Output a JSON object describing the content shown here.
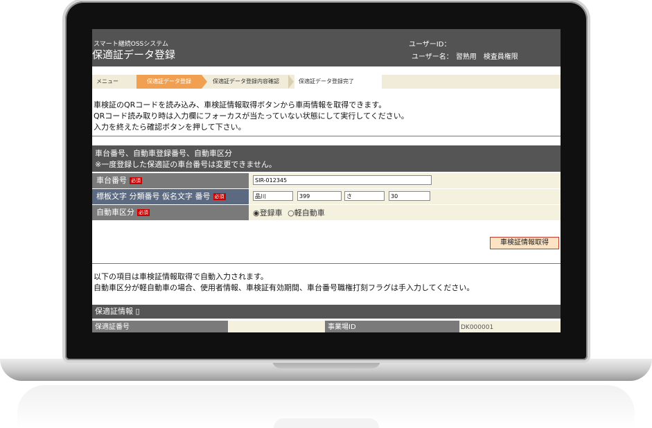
{
  "header": {
    "system_name": "スマート継続OSSシステム",
    "page_title": "保適証データ登録",
    "user_id_label": "ユーザーID：",
    "user_name_label": "ユーザー名：",
    "user_name_value": "習熟用　検査員権限"
  },
  "breadcrumb": [
    {
      "label": "メニュー"
    },
    {
      "label": "保適証データ登録"
    },
    {
      "label": "保適証データ登録内容確認"
    },
    {
      "label": "保適証データ登録完了"
    }
  ],
  "intro": [
    "車検証のQRコードを読み込み、車検証情報取得ボタンから車両情報を取得できます。",
    "QRコード読み取り時は入力欄にフォーカスが当たっていない状態にして実行してください。",
    "入力を終えたら確認ボタンを押して下さい。"
  ],
  "section_vehicle": {
    "line1": "車台番号、自動車登録番号、自動車区分",
    "line2": "※一度登録した保適証の車台番号は変更できません。"
  },
  "required_badge": "必須",
  "fields": {
    "chassis_label": "車台番号",
    "chassis_value": "SIR-012345",
    "plate_label": "標板文字 分類番号 仮名文字 番号",
    "plate_region": "品川",
    "plate_class": "399",
    "plate_kana": "さ",
    "plate_number": "30",
    "category_label": "自動車区分",
    "category_options": [
      "登録車",
      "軽自動車"
    ]
  },
  "fetch_button": "車検証情報取得",
  "auto_note": [
    "以下の項目は車検証情報取得で自動入力されます。",
    "自動車区分が軽自動車の場合、使用者情報、車検証有効期間、車台番号職権打刻フラグは手入力してください。"
  ],
  "section_cert": {
    "title": "保適証情報"
  },
  "cert_row": {
    "cert_no_label": "保適証番号",
    "office_id_label": "事業場ID",
    "office_id_value": "DK000001"
  }
}
